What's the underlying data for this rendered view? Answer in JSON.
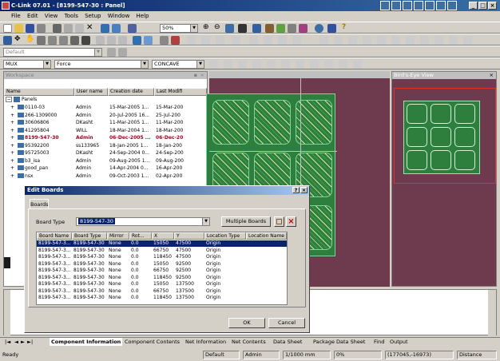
{
  "title": "C-Link 07.01 - [8199-547-30 : Panel]",
  "menu": [
    "File",
    "Edit",
    "View",
    "Tools",
    "Setup",
    "Window",
    "Help"
  ],
  "toolbar": {
    "zoom": "50%"
  },
  "toolbar3": {
    "layer": "Default"
  },
  "toolbar4": {
    "mux": "MUX",
    "force": "Force",
    "concave": "CONCAVE"
  },
  "workspace": {
    "title": "Workspace",
    "columns": [
      "Name",
      "User name",
      "Creation date",
      "Last Modifi"
    ],
    "root": "Panels",
    "rows": [
      {
        "name": "0110-03",
        "user": "Admin",
        "created": "15-Mar-2005 1...",
        "modified": "15-Mar-200"
      },
      {
        "name": "266-1309000",
        "user": "Admin",
        "created": "20-Jul-2005 16...",
        "modified": "25-Jul-200"
      },
      {
        "name": "30606806",
        "user": "DKasht",
        "created": "11-Mar-2005 1...",
        "modified": "11-Mar-200"
      },
      {
        "name": "41295804",
        "user": "WILL",
        "created": "18-Mar-2004 1...",
        "modified": "18-Mar-200"
      },
      {
        "name": "8199-547-30",
        "user": "Admin",
        "created": "06-Dec-2005 ...",
        "modified": "06-Dec-20"
      },
      {
        "name": "95392200",
        "user": "ss133965",
        "created": "18-Jan-2005 1...",
        "modified": "18-Jan-200"
      },
      {
        "name": "95725003",
        "user": "DKasht",
        "created": "24-Sep-2004 0...",
        "modified": "24-Sep-200"
      },
      {
        "name": "b3_isa",
        "user": "Admin",
        "created": "09-Aug-2005 1...",
        "modified": "09-Aug-200"
      },
      {
        "name": "good_pan",
        "user": "Admin",
        "created": "14-Apr-2004 0...",
        "modified": "16-Apr-200"
      },
      {
        "name": "nsx",
        "user": "Admin",
        "created": "09-Oct-2003 1...",
        "modified": "02-Apr-200"
      }
    ]
  },
  "birdseye": {
    "title": "Bird's-Eye View"
  },
  "dialog": {
    "title": "Edit Boards",
    "tab": "Boards",
    "board_type_label": "Board Type",
    "board_type_value": "8199-547-30",
    "multiple_boards": "Multiple Boards",
    "columns": [
      "Board Name",
      "Board Type",
      "Mirror",
      "Rot...",
      "X",
      "Y",
      "Location Type",
      "Location Name"
    ],
    "rows": [
      [
        "8199-547-3...",
        "8199-547-30",
        "None",
        "0.0",
        "15050",
        "47500",
        "Origin",
        ""
      ],
      [
        "8199-547-3...",
        "8199-547-30",
        "None",
        "0.0",
        "66750",
        "47500",
        "Origin",
        ""
      ],
      [
        "8199-547-3...",
        "8199-547-30",
        "None",
        "0.0",
        "118450",
        "47500",
        "Origin",
        ""
      ],
      [
        "8199-547-3...",
        "8199-547-30",
        "None",
        "0.0",
        "15050",
        "92500",
        "Origin",
        ""
      ],
      [
        "8199-547-3...",
        "8199-547-30",
        "None",
        "0.0",
        "66750",
        "92500",
        "Origin",
        ""
      ],
      [
        "8199-547-3...",
        "8199-547-30",
        "None",
        "0.0",
        "118450",
        "92500",
        "Origin",
        ""
      ],
      [
        "8199-547-3...",
        "8199-547-30",
        "None",
        "0.0",
        "15050",
        "137500",
        "Origin",
        ""
      ],
      [
        "8199-547-3...",
        "8199-547-30",
        "None",
        "0.0",
        "66750",
        "137500",
        "Origin",
        ""
      ],
      [
        "8199-547-3...",
        "8199-547-30",
        "None",
        "0.0",
        "118450",
        "137500",
        "Origin",
        ""
      ]
    ],
    "ok": "OK",
    "cancel": "Cancel"
  },
  "tabs": [
    "Component Information",
    "Component Contents",
    "Net Information",
    "Net Contents",
    "Data Sheet",
    "Package Data Sheet",
    "Find",
    "Output"
  ],
  "status": {
    "ready": "Ready",
    "layer": "Default",
    "user": "Admin",
    "scale": "1/1000 mm",
    "percent": "0%",
    "coords": "(177045,-16973)",
    "mode": "Distance"
  },
  "colors": {
    "canvas": "#6e3a4e",
    "board": "#2e7f3e",
    "titlebar": "#0a246a",
    "selected_row": "#a50021"
  }
}
